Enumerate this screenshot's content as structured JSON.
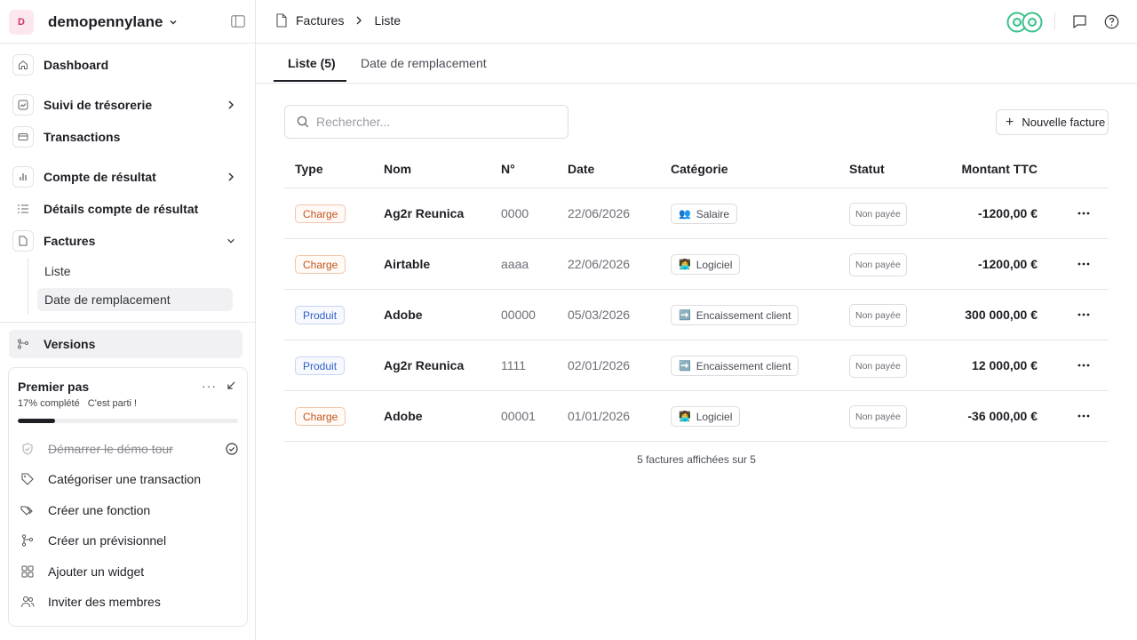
{
  "workspace": {
    "initial": "D",
    "name": "demopennylane"
  },
  "nav": {
    "dashboard": "Dashboard",
    "tresorerie": "Suivi de trésorerie",
    "transactions": "Transactions",
    "compte_resultat": "Compte de résultat",
    "details_compte": "Détails compte de résultat",
    "factures": "Factures",
    "factures_sub": {
      "liste": "Liste",
      "date_remplacement": "Date de remplacement"
    },
    "versions": "Versions"
  },
  "onboarding": {
    "title": "Premier pas",
    "more": "···",
    "progress_text": "17% complété",
    "cta": "C'est parti !",
    "progress": 0.17,
    "steps": [
      {
        "label": "Démarrer le démo tour",
        "done": true,
        "icon": "badge-icon"
      },
      {
        "label": "Catégoriser une transaction",
        "done": false,
        "icon": "tag-icon"
      },
      {
        "label": "Créer une fonction",
        "done": false,
        "icon": "tags-icon"
      },
      {
        "label": "Créer un prévisionnel",
        "done": false,
        "icon": "forecast-icon"
      },
      {
        "label": "Ajouter un widget",
        "done": false,
        "icon": "widget-icon"
      },
      {
        "label": "Inviter des membres",
        "done": false,
        "icon": "users-icon"
      }
    ]
  },
  "breadcrumb": {
    "section": "Factures",
    "page": "Liste"
  },
  "tabs": {
    "liste": "Liste (5)",
    "date_remplacement": "Date de remplacement"
  },
  "search": {
    "placeholder": "Rechercher..."
  },
  "new_invoice": "Nouvelle facture",
  "table": {
    "headers": {
      "type": "Type",
      "nom": "Nom",
      "num": "N°",
      "date": "Date",
      "categorie": "Catégorie",
      "statut": "Statut",
      "montant": "Montant TTC"
    },
    "rows": [
      {
        "type": "Charge",
        "nom": "Ag2r Reunica",
        "num": "0000",
        "date": "22/06/2026",
        "categorie": "Salaire",
        "cat_emoji": "👥",
        "statut": "Non payée",
        "montant": "-1200,00 €"
      },
      {
        "type": "Charge",
        "nom": "Airtable",
        "num": "aaaa",
        "date": "22/06/2026",
        "categorie": "Logiciel",
        "cat_emoji": "👩‍💻",
        "statut": "Non payée",
        "montant": "-1200,00 €"
      },
      {
        "type": "Produit",
        "nom": "Adobe",
        "num": "00000",
        "date": "05/03/2026",
        "categorie": "Encaissement client",
        "cat_emoji": "➡️",
        "statut": "Non payée",
        "montant": "300 000,00 €"
      },
      {
        "type": "Produit",
        "nom": "Ag2r Reunica",
        "num": "1111",
        "date": "02/01/2026",
        "categorie": "Encaissement client",
        "cat_emoji": "➡️",
        "statut": "Non payée",
        "montant": "12 000,00 €"
      },
      {
        "type": "Charge",
        "nom": "Adobe",
        "num": "00001",
        "date": "01/01/2026",
        "categorie": "Logiciel",
        "cat_emoji": "👩‍💻",
        "statut": "Non payée",
        "montant": "-36 000,00 €"
      }
    ]
  },
  "footer_count": "5 factures affichées sur 5",
  "colors": {
    "charge": "#c2551f",
    "produit": "#2f5ec4",
    "accent": "#1d1f24",
    "avatar_green": "#3cc08a"
  }
}
